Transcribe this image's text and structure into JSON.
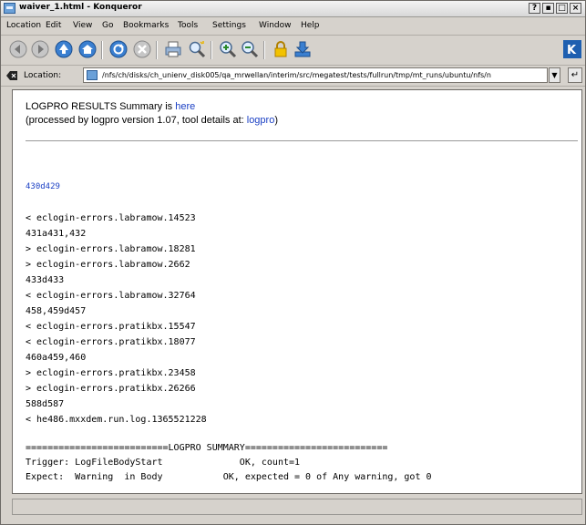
{
  "window": {
    "title": "waiver_1.html - Konqueror",
    "buttons": [
      "?",
      "▪",
      "□",
      "×"
    ]
  },
  "menubar": {
    "items": [
      "Location",
      "Edit",
      "View",
      "Go",
      "Bookmarks",
      "Tools",
      "Settings",
      "Window",
      "Help"
    ]
  },
  "toolbar": {
    "icons": [
      "back-icon",
      "forward-icon",
      "up-icon",
      "home-icon",
      "reload-icon",
      "stop-icon",
      "print-icon",
      "find-icon",
      "zoom-in-icon",
      "zoom-out-icon",
      "security-icon",
      "download-icon",
      "konqueror-logo"
    ]
  },
  "locationbar": {
    "label": "Location:",
    "url": "/nfs/ch/disks/ch_unienv_disk005/qa_mrwellan/interim/src/megatest/tests/fullrun/tmp/mt_runs/ubuntu/nfs/n",
    "dropdown": "▼",
    "go": "↵"
  },
  "content": {
    "summary_prefix": "LOGPRO RESULTS Summary is ",
    "summary_link": "here",
    "processed_prefix": "(processed by logpro version 1.07, tool details at: ",
    "processed_link": "logpro",
    "processed_suffix": ")",
    "diff_header": "430d429",
    "diff_lines": [
      "< eclogin-errors.labramow.14523",
      "431a431,432",
      "> eclogin-errors.labramow.18281",
      "> eclogin-errors.labramow.2662",
      "433d433",
      "< eclogin-errors.labramow.32764",
      "458,459d457",
      "< eclogin-errors.pratikbx.15547",
      "< eclogin-errors.pratikbx.18077",
      "460a459,460",
      "> eclogin-errors.pratikbx.23458",
      "> eclogin-errors.pratikbx.26266",
      "588d587",
      "< he486.mxxdem.run.log.1365521228"
    ],
    "summary_lines": [
      "==========================LOGPRO SUMMARY==========================",
      "Trigger: LogFileBodyStart              OK, count=1",
      "Expect:  Warning  in Body           OK, expected = 0 of Any warning, got 0"
    ]
  },
  "status": {
    "text": ""
  }
}
